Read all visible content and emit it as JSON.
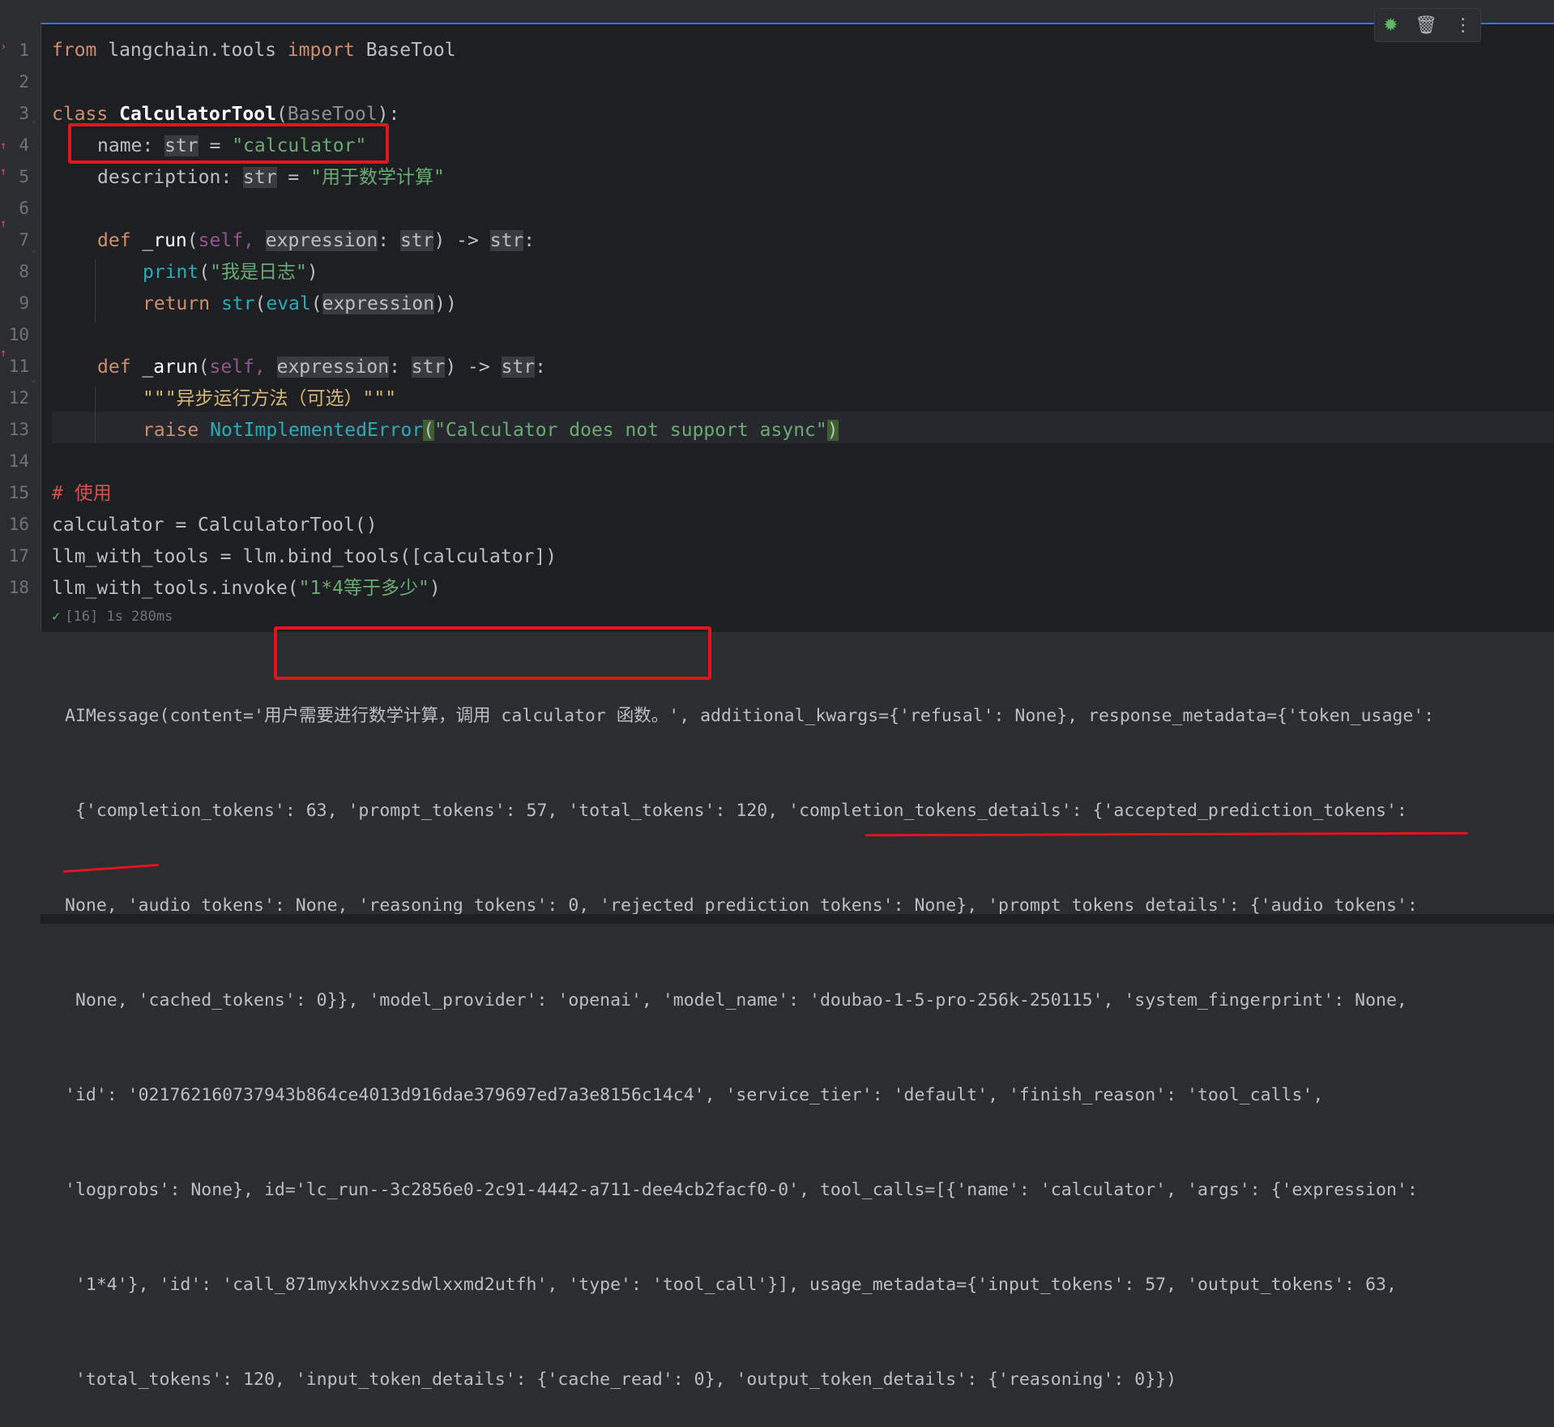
{
  "toolbar": {
    "icons": [
      "bug-icon",
      "trash-icon",
      "more-vertical-icon"
    ]
  },
  "line_numbers": [
    "1",
    "2",
    "3",
    "4",
    "5",
    "6",
    "7",
    "8",
    "9",
    "10",
    "11",
    "12",
    "13",
    "14",
    "15",
    "16",
    "17",
    "18"
  ],
  "code": {
    "l1": {
      "kw_from": "from",
      "module": " langchain.tools ",
      "kw_import": "import",
      "name": " BaseTool"
    },
    "l3": {
      "kw": "class",
      "cls": "CalculatorTool",
      "paren_open": "(",
      "base": "BaseTool",
      "end": "):"
    },
    "l4": {
      "name": "name",
      "colon": ": ",
      "type": "str",
      "eq": " = ",
      "value": "\"calculator\""
    },
    "l5": {
      "name": "description",
      "colon": ": ",
      "type": "str",
      "eq": " = ",
      "value": "\"用于数学计算\""
    },
    "l7": {
      "kw": "def",
      "fn": " _run",
      "open": "(",
      "self": "self, ",
      "param": "expression",
      "colon": ": ",
      "type1": "str",
      "close": ") -> ",
      "type2": "str",
      "end": ":"
    },
    "l8": {
      "fn": "print",
      "open": "(",
      "value": "\"我是日志\"",
      "close": ")"
    },
    "l9": {
      "kw": "return",
      "sp": " ",
      "f1": "str",
      "o1": "(",
      "f2": "eval",
      "o2": "(",
      "param": "expression",
      "close": "))"
    },
    "l11": {
      "kw": "def",
      "fn": " _arun",
      "open": "(",
      "self": "self, ",
      "param": "expression",
      "colon": ": ",
      "type1": "str",
      "close": ") -> ",
      "type2": "str",
      "end": ":"
    },
    "l12": {
      "doc": "\"\"\"异步运行方法（可选）\"\"\""
    },
    "l13": {
      "kw": "raise",
      "sp": " ",
      "cls": "NotImplementedError",
      "open": "(",
      "value": "\"Calculator does not support async\"",
      "close": ")"
    },
    "l15": {
      "comment": "# 使用"
    },
    "l16": {
      "text": "calculator = CalculatorTool()"
    },
    "l17": {
      "text": "llm_with_tools = llm.bind_tools([calculator])"
    },
    "l18": {
      "pre": "llm_with_tools.invoke(",
      "value": "\"1*4等于多少\"",
      "post": ")"
    }
  },
  "status": {
    "text": "[16] 1s 280ms"
  },
  "output": {
    "lines": [
      "AIMessage(content='用户需要进行数学计算，调用 calculator 函数。', additional_kwargs={'refusal': None}, response_metadata={'token_usage':",
      " {'completion_tokens': 63, 'prompt_tokens': 57, 'total_tokens': 120, 'completion_tokens_details': {'accepted_prediction_tokens':",
      "None, 'audio_tokens': None, 'reasoning_tokens': 0, 'rejected_prediction_tokens': None}, 'prompt_tokens_details': {'audio_tokens':",
      " None, 'cached_tokens': 0}}, 'model_provider': 'openai', 'model_name': 'doubao-1-5-pro-256k-250115', 'system_fingerprint': None,",
      "'id': '021762160737943b864ce4013d916dae379697ed7a3e8156c14c4', 'service_tier': 'default', 'finish_reason': 'tool_calls',",
      "'logprobs': None}, id='lc_run--3c2856e0-2c91-4442-a711-dee4cb2facf0-0', tool_calls=[{'name': 'calculator', 'args': {'expression':",
      " '1*4'}, 'id': 'call_871myxkhvxzsdwlxxmd2utfh', 'type': 'tool_call'}], usage_metadata={'input_tokens': 57, 'output_tokens': 63,",
      " 'total_tokens': 120, 'input_token_details': {'cache_read': 0}, 'output_token_details': {'reasoning': 0}})"
    ]
  },
  "annotation_color": "#e3141d"
}
